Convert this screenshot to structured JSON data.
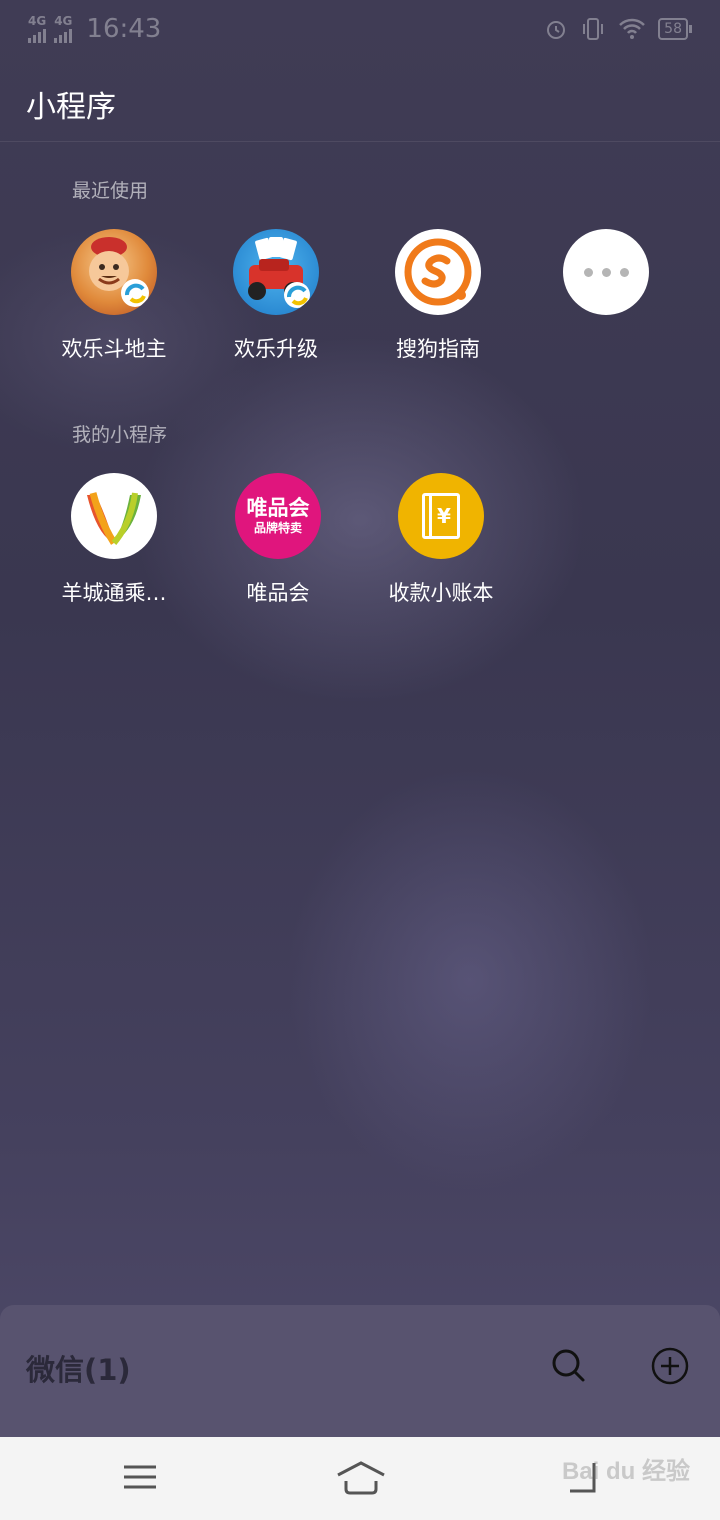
{
  "status_bar": {
    "signal1": "4G",
    "signal2": "4G",
    "time": "16:43",
    "battery": "58"
  },
  "header": {
    "title": "小程序"
  },
  "recent": {
    "label": "最近使用",
    "items": [
      {
        "name": "欢乐斗地主",
        "icon": "doudizhu-game-icon"
      },
      {
        "name": "欢乐升级",
        "icon": "shengji-game-icon"
      },
      {
        "name": "搜狗指南",
        "icon": "sogou-icon"
      },
      {
        "name": "",
        "icon": "more-icon"
      }
    ]
  },
  "mine": {
    "label": "我的小程序",
    "items": [
      {
        "name": "羊城通乘…",
        "icon": "yangchengtong-icon"
      },
      {
        "name": "唯品会",
        "icon": "vipshop-icon",
        "logo_line1": "唯品会",
        "logo_line2": "品牌特卖"
      },
      {
        "name": "收款小账本",
        "icon": "ledger-icon",
        "logo_symbol": "¥"
      }
    ]
  },
  "wechat_bar": {
    "title": "微信(1)"
  },
  "watermark": "Bai du 经验",
  "colors": {
    "vipshop": "#e0157d",
    "ledger": "#f0b400",
    "sogou": "#f07a1a"
  }
}
